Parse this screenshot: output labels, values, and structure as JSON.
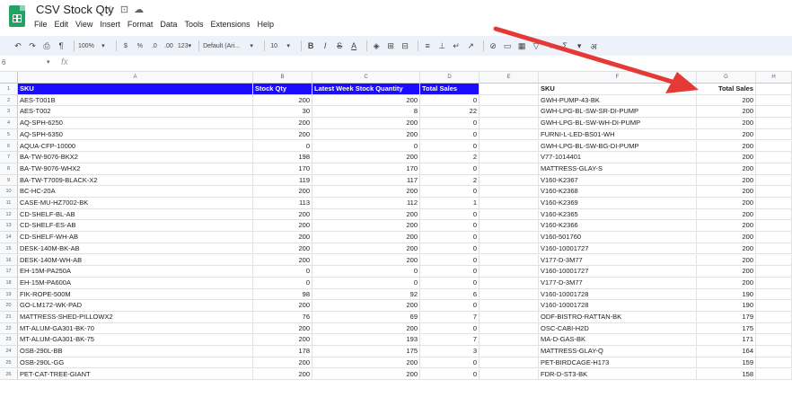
{
  "window": {
    "doc_title": "CSV Stock Qty",
    "title_icons": [
      "star-icon",
      "move-icon",
      "cloud-status-icon"
    ]
  },
  "menu": [
    "File",
    "Edit",
    "View",
    "Insert",
    "Format",
    "Data",
    "Tools",
    "Extensions",
    "Help"
  ],
  "toolbar": {
    "zoom": "100%",
    "currency": "$",
    "percent": "%",
    "dec_decrease": ".0",
    "dec_increase": ".00",
    "more_formats": "123▾",
    "font": "Default (Ari...",
    "font_size": "10",
    "bold": "B",
    "italic": "I",
    "strike": "S",
    "text_color": "A",
    "sum": "Σ"
  },
  "formula_bar": {
    "name_box": "6",
    "fx": "fx"
  },
  "columns": [
    "A",
    "B",
    "C",
    "D",
    "E",
    "F",
    "G",
    "H"
  ],
  "headers": {
    "sku": "SKU",
    "stock_qty": "Stock Qty",
    "latest_week": "Latest Week Stock Quantity",
    "total_sales": "Total Sales",
    "sku2": "SKU",
    "total_sales2": "Total Sales"
  },
  "rows": [
    {
      "n": "2",
      "sku": "AES-T001B",
      "qty": "200",
      "latest": "200",
      "sales": "0",
      "sku2": "GWH-PUMP-43-BK",
      "sales2": "200"
    },
    {
      "n": "3",
      "sku": "AES-T002",
      "qty": "30",
      "latest": "8",
      "sales": "22",
      "sku2": "GWH-LPG-BL-SW-SR-DI-PUMP",
      "sales2": "200"
    },
    {
      "n": "4",
      "sku": "AQ-SPH-6250",
      "qty": "200",
      "latest": "200",
      "sales": "0",
      "sku2": "GWH-LPG-BL-SW-WH-DI-PUMP",
      "sales2": "200"
    },
    {
      "n": "5",
      "sku": "AQ-SPH-6350",
      "qty": "200",
      "latest": "200",
      "sales": "0",
      "sku2": "FURNI-L-LED-BS01-WH",
      "sales2": "200"
    },
    {
      "n": "6",
      "sku": "AQUA-CFP-10000",
      "qty": "0",
      "latest": "0",
      "sales": "0",
      "sku2": "GWH-LPG-BL-SW-BG-DI-PUMP",
      "sales2": "200"
    },
    {
      "n": "7",
      "sku": "BA-TW-9076-BKX2",
      "qty": "198",
      "latest": "200",
      "sales": "2",
      "sku2": "V77-1014401",
      "sales2": "200"
    },
    {
      "n": "8",
      "sku": "BA-TW-9076-WHX2",
      "qty": "170",
      "latest": "170",
      "sales": "0",
      "sku2": "MATTRESS-GLAY-S",
      "sales2": "200"
    },
    {
      "n": "9",
      "sku": "BA-TW-T7009-BLACK-X2",
      "qty": "119",
      "latest": "117",
      "sales": "2",
      "sku2": "V160-K2367",
      "sales2": "200"
    },
    {
      "n": "10",
      "sku": "BC-HC-20A",
      "qty": "200",
      "latest": "200",
      "sales": "0",
      "sku2": "V160-K2368",
      "sales2": "200"
    },
    {
      "n": "11",
      "sku": "CASE-MU-HZ7002-BK",
      "qty": "113",
      "latest": "112",
      "sales": "1",
      "sku2": "V160-K2369",
      "sales2": "200"
    },
    {
      "n": "12",
      "sku": "CD-SHELF-BL-AB",
      "qty": "200",
      "latest": "200",
      "sales": "0",
      "sku2": "V160-K2365",
      "sales2": "200"
    },
    {
      "n": "13",
      "sku": "CD-SHELF-ES-AB",
      "qty": "200",
      "latest": "200",
      "sales": "0",
      "sku2": "V160-K2366",
      "sales2": "200"
    },
    {
      "n": "14",
      "sku": "CD-SHELF-WH-AB",
      "qty": "200",
      "latest": "200",
      "sales": "0",
      "sku2": "V160-501760",
      "sales2": "200"
    },
    {
      "n": "15",
      "sku": "DESK-140M-BK-AB",
      "qty": "200",
      "latest": "200",
      "sales": "0",
      "sku2": "V160-10001727",
      "sales2": "200"
    },
    {
      "n": "16",
      "sku": "DESK-140M-WH-AB",
      "qty": "200",
      "latest": "200",
      "sales": "0",
      "sku2": "V177-D-3M77",
      "sales2": "200"
    },
    {
      "n": "17",
      "sku": "EH-15M-PA250A",
      "qty": "0",
      "latest": "0",
      "sales": "0",
      "sku2": "V160-10001727",
      "sales2": "200"
    },
    {
      "n": "18",
      "sku": "EH-15M-PA600A",
      "qty": "0",
      "latest": "0",
      "sales": "0",
      "sku2": "V177-D-3M77",
      "sales2": "200"
    },
    {
      "n": "19",
      "sku": "FIK-ROPE-500M",
      "qty": "98",
      "latest": "92",
      "sales": "6",
      "sku2": "V160-10001728",
      "sales2": "190"
    },
    {
      "n": "20",
      "sku": "GO-LM172-WK-PAD",
      "qty": "200",
      "latest": "200",
      "sales": "0",
      "sku2": "V160-10001728",
      "sales2": "190"
    },
    {
      "n": "21",
      "sku": "MATTRESS-SHED-PILLOWX2",
      "qty": "76",
      "latest": "69",
      "sales": "7",
      "sku2": "ODF-BISTRO-RATTAN-BK",
      "sales2": "179"
    },
    {
      "n": "22",
      "sku": "MT-ALUM-GA301-BK-70",
      "qty": "200",
      "latest": "200",
      "sales": "0",
      "sku2": "OSC-CABI-H2D",
      "sales2": "175"
    },
    {
      "n": "23",
      "sku": "MT-ALUM-GA301-BK-75",
      "qty": "200",
      "latest": "193",
      "sales": "7",
      "sku2": "MA-D-GAS-BK",
      "sales2": "171"
    },
    {
      "n": "24",
      "sku": "OSB-290L-BB",
      "qty": "178",
      "latest": "175",
      "sales": "3",
      "sku2": "MATTRESS-GLAY-Q",
      "sales2": "164"
    },
    {
      "n": "25",
      "sku": "OSB-290L-GG",
      "qty": "200",
      "latest": "200",
      "sales": "0",
      "sku2": "PET-BIRDCAGE-H173",
      "sales2": "159"
    },
    {
      "n": "26",
      "sku": "PET-CAT-TREE-GIANT",
      "qty": "200",
      "latest": "200",
      "sales": "0",
      "sku2": "FDR-D-ST3-BK",
      "sales2": "158"
    }
  ],
  "colors": {
    "header_fill": "#1a0dff",
    "arrow": "#e53935",
    "sheets_green": "#1fa463"
  }
}
